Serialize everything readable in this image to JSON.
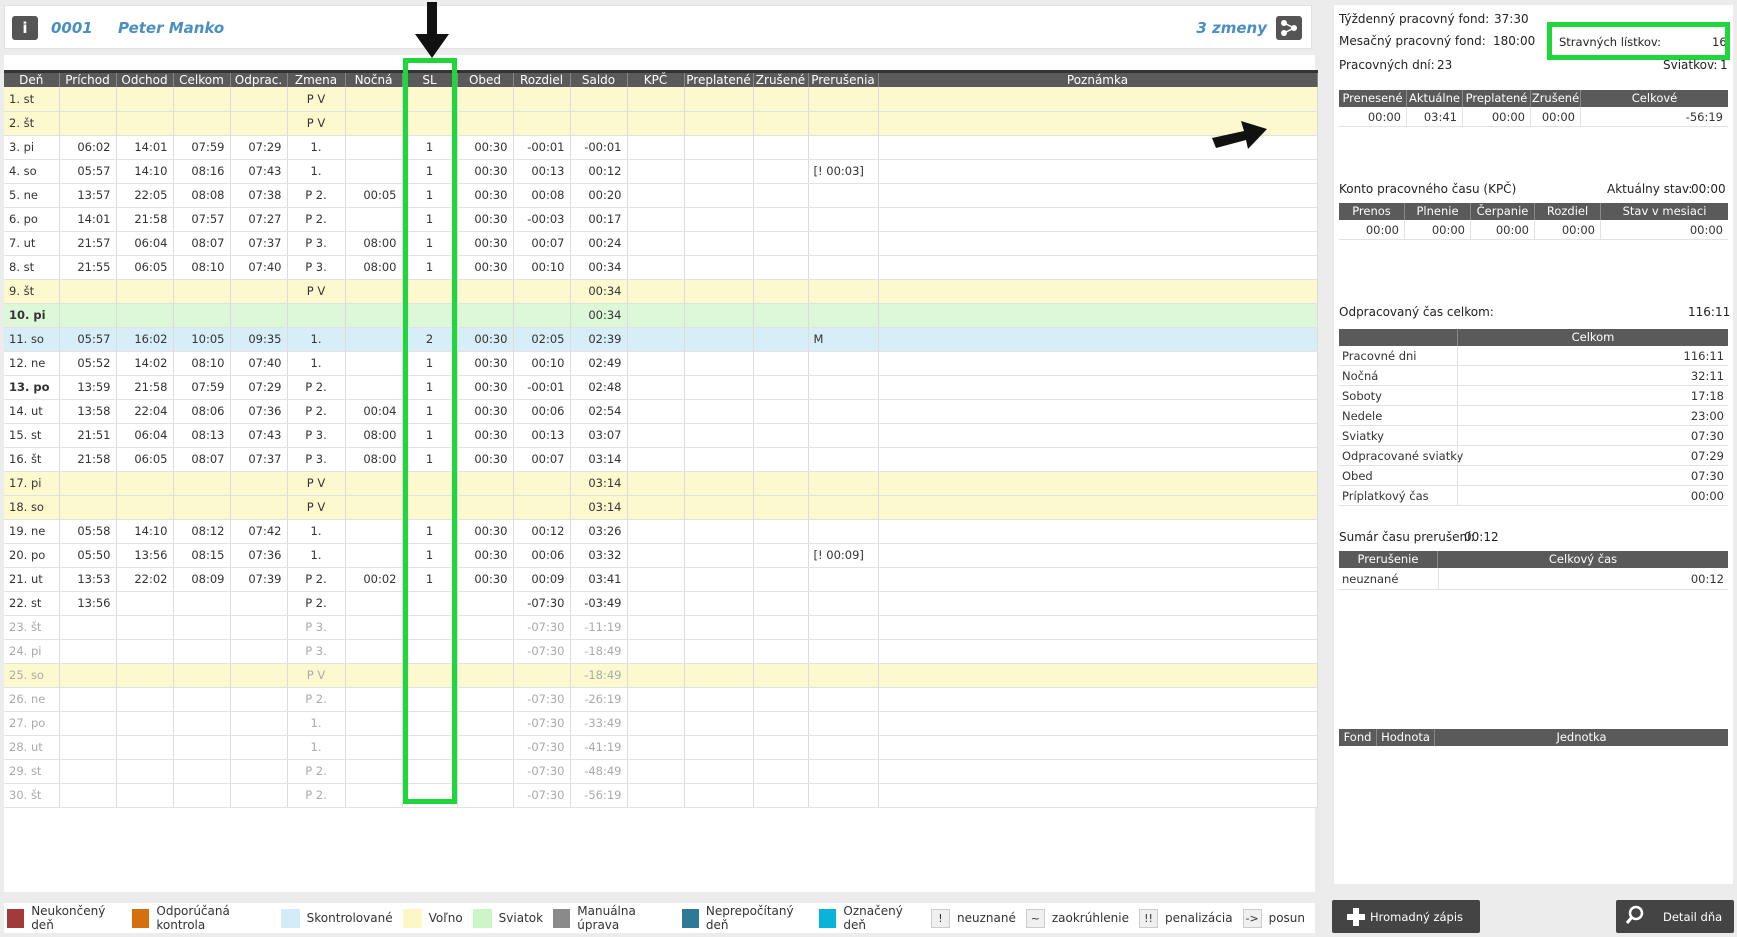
{
  "header": {
    "emp_id": "0001",
    "emp_name": "Peter Manko",
    "shifts": "3 zmeny"
  },
  "table": {
    "columns": [
      "Deň",
      "Príchod",
      "Odchod",
      "Celkom",
      "Odprac.",
      "Zmena",
      "Nočná",
      "SL",
      "Obed",
      "Rozdiel",
      "Saldo",
      "KPČ",
      "Preplatené",
      "Zrušené",
      "Prerušenia",
      "Poznámka"
    ],
    "rows": [
      {
        "cls": "off",
        "c": [
          "1. st",
          "",
          "",
          "",
          "",
          "P V",
          "",
          "",
          "",
          "",
          "",
          "",
          "",
          "",
          "",
          ""
        ]
      },
      {
        "cls": "off",
        "c": [
          "2. št",
          "",
          "",
          "",
          "",
          "P V",
          "",
          "",
          "",
          "",
          "",
          "",
          "",
          "",
          "",
          ""
        ]
      },
      {
        "cls": "wk",
        "c": [
          "3. pi",
          "06:02",
          "14:01",
          "07:59",
          "07:29",
          "1.",
          "",
          "1",
          "00:30",
          "-00:01",
          "-00:01",
          "",
          "",
          "",
          "",
          ""
        ]
      },
      {
        "cls": "wk",
        "c": [
          "4. so",
          "05:57",
          "14:10",
          "08:16",
          "07:43",
          "1.",
          "",
          "1",
          "00:30",
          "00:13",
          "00:12",
          "",
          "",
          "",
          "[! 00:03]",
          ""
        ]
      },
      {
        "cls": "wk",
        "c": [
          "5. ne",
          "13:57",
          "22:05",
          "08:08",
          "07:38",
          "P 2.",
          "00:05",
          "1",
          "00:30",
          "00:08",
          "00:20",
          "",
          "",
          "",
          "",
          ""
        ]
      },
      {
        "cls": "wk",
        "c": [
          "6. po",
          "14:01",
          "21:58",
          "07:57",
          "07:27",
          "P 2.",
          "",
          "1",
          "00:30",
          "-00:03",
          "00:17",
          "",
          "",
          "",
          "",
          ""
        ]
      },
      {
        "cls": "wk",
        "c": [
          "7. ut",
          "21:57",
          "06:04",
          "08:07",
          "07:37",
          "P 3.",
          "08:00",
          "1",
          "00:30",
          "00:07",
          "00:24",
          "",
          "",
          "",
          "",
          ""
        ]
      },
      {
        "cls": "wk",
        "c": [
          "8. st",
          "21:55",
          "06:05",
          "08:10",
          "07:40",
          "P 3.",
          "08:00",
          "1",
          "00:30",
          "00:10",
          "00:34",
          "",
          "",
          "",
          "",
          ""
        ]
      },
      {
        "cls": "off",
        "c": [
          "9. št",
          "",
          "",
          "",
          "",
          "P V",
          "",
          "",
          "",
          "",
          "00:34",
          "",
          "",
          "",
          "",
          ""
        ]
      },
      {
        "cls": "hol bold",
        "c": [
          "10. pi",
          "",
          "",
          "",
          "",
          "",
          "",
          "",
          "",
          "",
          "00:34",
          "",
          "",
          "",
          "",
          ""
        ]
      },
      {
        "cls": "chk",
        "c": [
          "11. so",
          "05:57",
          "16:02",
          "10:05",
          "09:35",
          "1.",
          "",
          "2",
          "00:30",
          "02:05",
          "02:39",
          "",
          "",
          "",
          "M",
          ""
        ]
      },
      {
        "cls": "wk",
        "c": [
          "12. ne",
          "05:52",
          "14:02",
          "08:10",
          "07:40",
          "1.",
          "",
          "1",
          "00:30",
          "00:10",
          "02:49",
          "",
          "",
          "",
          "",
          ""
        ]
      },
      {
        "cls": "wk bold",
        "c": [
          "13. po",
          "13:59",
          "21:58",
          "07:59",
          "07:29",
          "P 2.",
          "",
          "1",
          "00:30",
          "-00:01",
          "02:48",
          "",
          "",
          "",
          "",
          ""
        ]
      },
      {
        "cls": "wk",
        "c": [
          "14. ut",
          "13:58",
          "22:04",
          "08:06",
          "07:36",
          "P 2.",
          "00:04",
          "1",
          "00:30",
          "00:06",
          "02:54",
          "",
          "",
          "",
          "",
          ""
        ]
      },
      {
        "cls": "wk",
        "c": [
          "15. st",
          "21:51",
          "06:04",
          "08:13",
          "07:43",
          "P 3.",
          "08:00",
          "1",
          "00:30",
          "00:13",
          "03:07",
          "",
          "",
          "",
          "",
          ""
        ]
      },
      {
        "cls": "wk",
        "c": [
          "16. št",
          "21:58",
          "06:05",
          "08:07",
          "07:37",
          "P 3.",
          "08:00",
          "1",
          "00:30",
          "00:07",
          "03:14",
          "",
          "",
          "",
          "",
          ""
        ]
      },
      {
        "cls": "off",
        "c": [
          "17. pi",
          "",
          "",
          "",
          "",
          "P V",
          "",
          "",
          "",
          "",
          "03:14",
          "",
          "",
          "",
          "",
          ""
        ]
      },
      {
        "cls": "off",
        "c": [
          "18. so",
          "",
          "",
          "",
          "",
          "P V",
          "",
          "",
          "",
          "",
          "03:14",
          "",
          "",
          "",
          "",
          ""
        ]
      },
      {
        "cls": "wk",
        "c": [
          "19. ne",
          "05:58",
          "14:10",
          "08:12",
          "07:42",
          "1.",
          "",
          "1",
          "00:30",
          "00:12",
          "03:26",
          "",
          "",
          "",
          "",
          ""
        ]
      },
      {
        "cls": "wk",
        "c": [
          "20. po",
          "05:50",
          "13:56",
          "08:15",
          "07:36",
          "1.",
          "",
          "1",
          "00:30",
          "00:06",
          "03:32",
          "",
          "",
          "",
          "[! 00:09]",
          ""
        ]
      },
      {
        "cls": "wk",
        "c": [
          "21. ut",
          "13:53",
          "22:02",
          "08:09",
          "07:39",
          "P 2.",
          "00:02",
          "1",
          "00:30",
          "00:09",
          "03:41",
          "",
          "",
          "",
          "",
          ""
        ]
      },
      {
        "cls": "wk",
        "c": [
          "22. st",
          "13:56",
          "",
          "",
          "",
          "P 2.",
          "",
          "",
          "",
          "-07:30",
          "-03:49",
          "",
          "",
          "",
          "",
          ""
        ]
      },
      {
        "cls": "wk fut",
        "c": [
          "23. št",
          "",
          "",
          "",
          "",
          "P 3.",
          "",
          "",
          "",
          "-07:30",
          "-11:19",
          "",
          "",
          "",
          "",
          ""
        ]
      },
      {
        "cls": "wk fut",
        "c": [
          "24. pi",
          "",
          "",
          "",
          "",
          "P 3.",
          "",
          "",
          "",
          "-07:30",
          "-18:49",
          "",
          "",
          "",
          "",
          ""
        ]
      },
      {
        "cls": "off fut",
        "c": [
          "25. so",
          "",
          "",
          "",
          "",
          "P V",
          "",
          "",
          "",
          "",
          "-18:49",
          "",
          "",
          "",
          "",
          ""
        ]
      },
      {
        "cls": "wk fut",
        "c": [
          "26. ne",
          "",
          "",
          "",
          "",
          "P 2.",
          "",
          "",
          "",
          "-07:30",
          "-26:19",
          "",
          "",
          "",
          "",
          ""
        ]
      },
      {
        "cls": "wk fut",
        "c": [
          "27. po",
          "",
          "",
          "",
          "",
          "1.",
          "",
          "",
          "",
          "-07:30",
          "-33:49",
          "",
          "",
          "",
          "",
          ""
        ]
      },
      {
        "cls": "wk fut",
        "c": [
          "28. ut",
          "",
          "",
          "",
          "",
          "1.",
          "",
          "",
          "",
          "-07:30",
          "-41:19",
          "",
          "",
          "",
          "",
          ""
        ]
      },
      {
        "cls": "wk fut",
        "c": [
          "29. st",
          "",
          "",
          "",
          "",
          "P 2.",
          "",
          "",
          "",
          "-07:30",
          "-48:49",
          "",
          "",
          "",
          "",
          ""
        ]
      },
      {
        "cls": "wk fut",
        "c": [
          "30. št",
          "",
          "",
          "",
          "",
          "P 2.",
          "",
          "",
          "",
          "-07:30",
          "-56:19",
          "",
          "",
          "",
          "",
          ""
        ]
      }
    ]
  },
  "summary": {
    "weekly_fund_label": "Týždenný pracovný fond:",
    "weekly_fund": "37:30",
    "monthly_fund_label": "Mesačný pracovný fond:",
    "monthly_fund": "180:00",
    "meal_label": "Stravných lístkov:",
    "meal": "16",
    "work_days_label": "Pracovných dní:",
    "work_days": "23",
    "holidays_label": "Sviatkov:",
    "holidays": "1"
  },
  "balance": {
    "cols": [
      "Prenesené",
      "Aktuálne",
      "Preplatené",
      "Zrušené",
      "Celkové"
    ],
    "vals": [
      "00:00",
      "03:41",
      "00:00",
      "00:00",
      "-56:19"
    ]
  },
  "kpc": {
    "title": "Konto pracovného času (KPČ)",
    "state_label": "Aktuálny stav:",
    "state": "00:00",
    "cols": [
      "Prenos",
      "Plnenie",
      "Čerpanie",
      "Rozdiel",
      "Stav v mesiaci"
    ],
    "vals": [
      "00:00",
      "00:00",
      "00:00",
      "00:00",
      "00:00"
    ]
  },
  "worked": {
    "title": "Odpracovaný čas celkom:",
    "total": "116:11",
    "col": "Celkom",
    "rows": [
      {
        "k": "Pracovné dni",
        "v": "116:11"
      },
      {
        "k": "Nočná",
        "v": "32:11"
      },
      {
        "k": "Soboty",
        "v": "17:18"
      },
      {
        "k": "Nedele",
        "v": "23:00"
      },
      {
        "k": "Sviatky",
        "v": "07:30"
      },
      {
        "k": "Odpracované sviatky",
        "v": "07:29"
      },
      {
        "k": "Obed",
        "v": "07:30"
      },
      {
        "k": "Príplatkový čas",
        "v": "00:00"
      }
    ]
  },
  "interruptions": {
    "title": "Sumár času prerušení:",
    "total": "00:12",
    "cols": [
      "Prerušenie",
      "Celkový čas"
    ],
    "row": {
      "k": "neuznané",
      "v": "00:12"
    }
  },
  "fund_table": {
    "cols": [
      "Fond",
      "Hodnota",
      "Jednotka"
    ]
  },
  "legend": [
    {
      "color": "#a33a3a",
      "label": "Neukončený deň"
    },
    {
      "color": "#d6700e",
      "label": "Odporúčaná kontrola"
    },
    {
      "color": "#d4ecf8",
      "label": "Skontrolované"
    },
    {
      "color": "#fdf7c4",
      "label": "Voľno"
    },
    {
      "color": "#cdf6c8",
      "label": "Sviatok"
    },
    {
      "color": "#8a8a8a",
      "label": "Manuálna úprava"
    },
    {
      "color": "#2e7a96",
      "label": "Neprepočítaný deň"
    },
    {
      "color": "#0ab4d8",
      "label": "Označený deň"
    }
  ],
  "legend_symbols": [
    {
      "sym": "!",
      "label": "neuznané"
    },
    {
      "sym": "~",
      "label": "zaokrúhlenie"
    },
    {
      "sym": "!!",
      "label": "penalizácia"
    },
    {
      "sym": "->",
      "label": "posun"
    }
  ],
  "buttons": {
    "bulk": "Hromadný zápis",
    "detail": "Detail dňa"
  }
}
